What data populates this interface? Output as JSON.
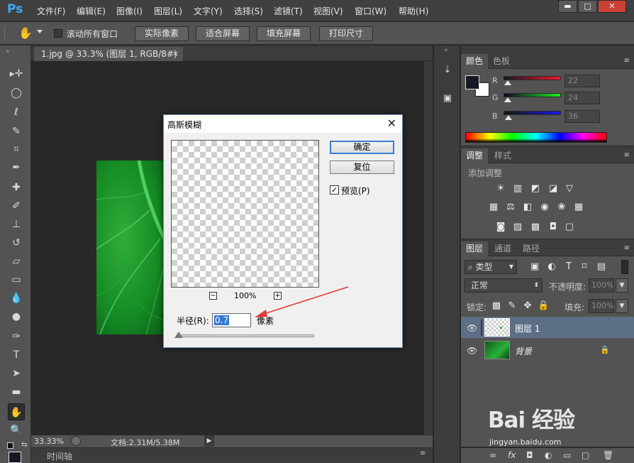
{
  "app": {
    "logo": "Ps"
  },
  "menu": [
    "文件(F)",
    "编辑(E)",
    "图像(I)",
    "图层(L)",
    "文字(Y)",
    "选择(S)",
    "滤镜(T)",
    "视图(V)",
    "窗口(W)",
    "帮助(H)"
  ],
  "window_controls": {
    "minimize": "▬",
    "maximize": "□",
    "close": "✕"
  },
  "options": {
    "scroll_all_label": "滚动所有窗口",
    "scroll_all_checked": false,
    "buttons": [
      "实际像素",
      "适合屏幕",
      "填充屏幕",
      "打印尺寸"
    ]
  },
  "document": {
    "tab_title": "1.jpg @ 33.3% (图层 1, RGB/8#) *",
    "tab_close": "×",
    "zoom": "33.33%",
    "doc_info": "文档:2.31M/5.38M",
    "timeline_label": "时间轴"
  },
  "color_panel": {
    "tabs": [
      "颜色",
      "色板"
    ],
    "channels": [
      {
        "label": "R",
        "value": "22"
      },
      {
        "label": "G",
        "value": "24"
      },
      {
        "label": "B",
        "value": "36"
      }
    ],
    "foreground": "#161824",
    "background": "#ffffff"
  },
  "adjust_panel": {
    "tabs": [
      "调整",
      "样式"
    ],
    "add_label": "添加调整"
  },
  "layers_panel": {
    "tabs": [
      "图层",
      "通道",
      "路径"
    ],
    "filter_kind": "类型",
    "blend_mode": "正常",
    "opacity_label": "不透明度:",
    "opacity_value": "100%",
    "lock_label": "锁定:",
    "fill_label": "填充:",
    "fill_value": "100%",
    "layers": [
      {
        "name": "图层 1",
        "selected": true,
        "locked": false
      },
      {
        "name": "背景",
        "selected": false,
        "locked": true
      }
    ],
    "footer_icons": [
      "link-icon",
      "fx-icon",
      "mask-icon",
      "adjustment-icon",
      "group-icon",
      "new-layer-icon",
      "trash-icon"
    ]
  },
  "dialog": {
    "title": "高斯模糊",
    "close": "✕",
    "ok_label": "确定",
    "reset_label": "复位",
    "preview_label": "预览(P)",
    "preview_checked": true,
    "zoom_minus": "−",
    "zoom_plus": "+",
    "zoom_value": "100%",
    "radius_label": "半径(R):",
    "radius_value": "0.7",
    "radius_unit": "像素"
  },
  "watermark": {
    "text": "Bai 经验",
    "url": "jingyan.baidu.com"
  },
  "colors": {
    "ps_blue": "#41a9f4",
    "selected_layer": "#5d6f86",
    "dialog_default_border": "#3b7fcf",
    "annotation_arrow": "#e53a3a"
  }
}
